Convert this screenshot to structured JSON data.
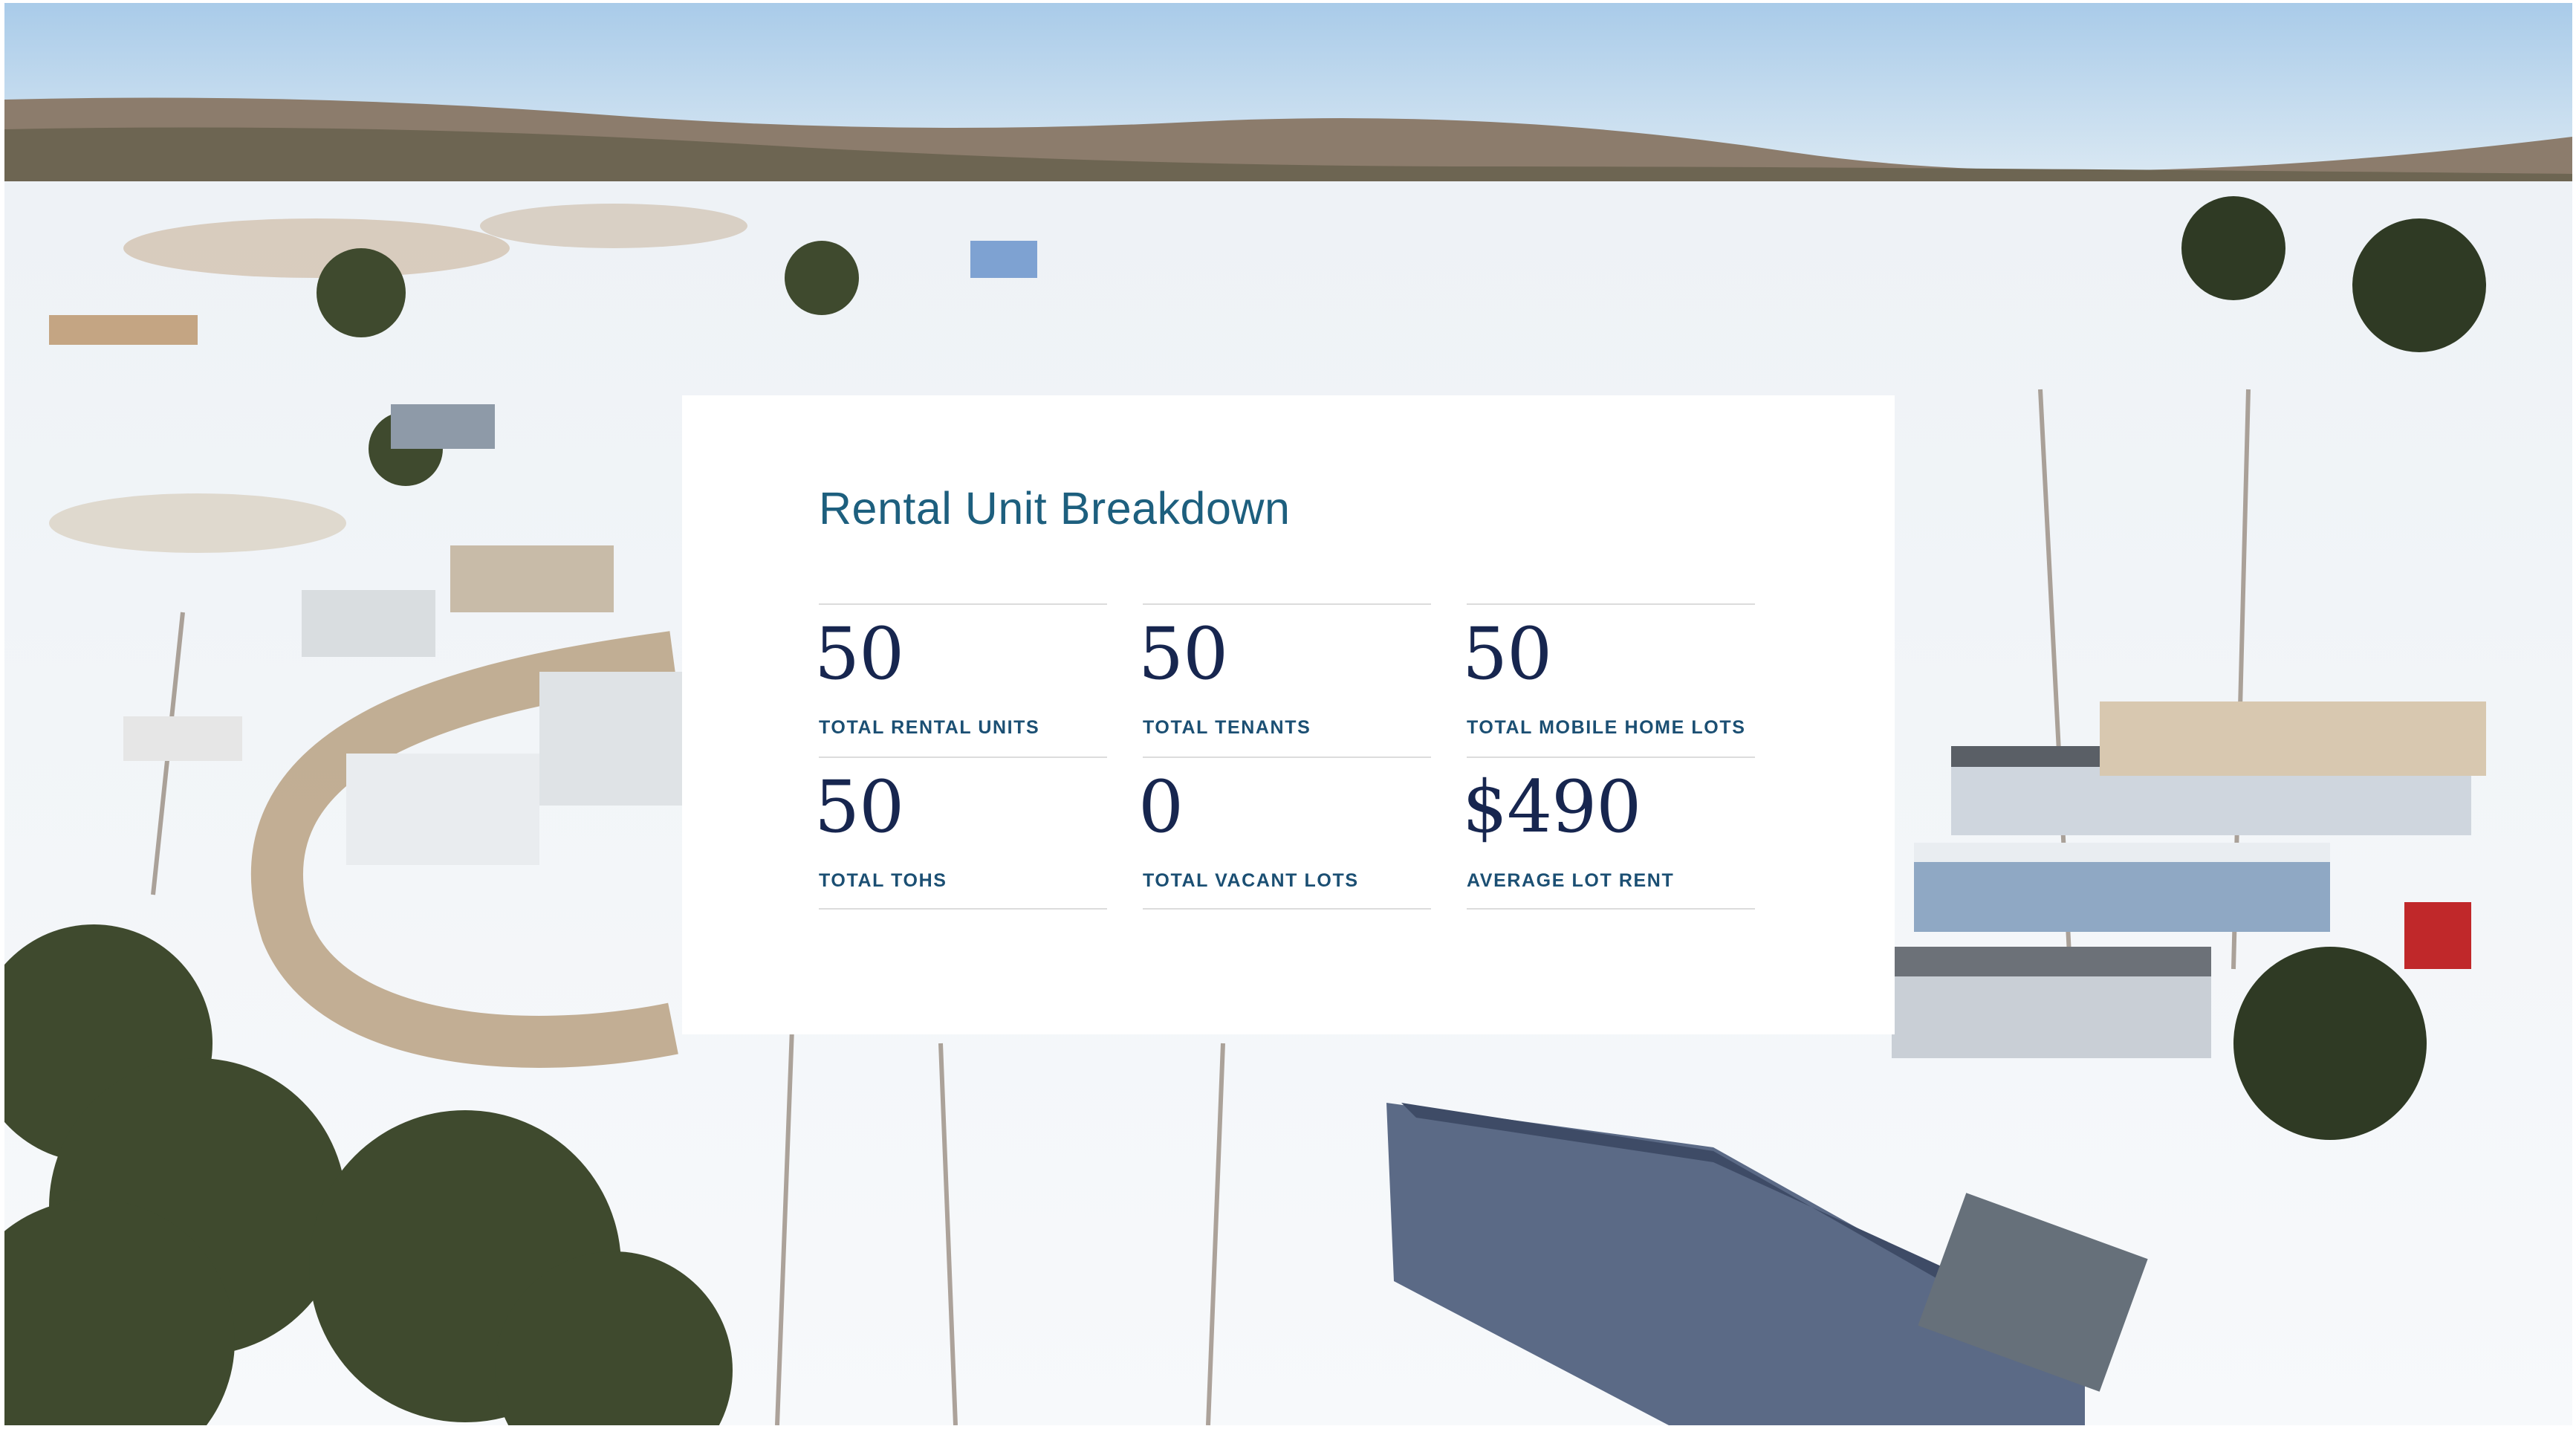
{
  "breakdown": {
    "title": "Rental Unit Breakdown",
    "stats": [
      {
        "value": "50",
        "label": "TOTAL RENTAL UNITS"
      },
      {
        "value": "50",
        "label": "TOTAL TENANTS"
      },
      {
        "value": "50",
        "label": "TOTAL MOBILE HOME LOTS"
      },
      {
        "value": "50",
        "label": "TOTAL TOHS"
      },
      {
        "value": "0",
        "label": "TOTAL VACANT LOTS"
      },
      {
        "value": "$490",
        "label": "AVERAGE LOT RENT"
      }
    ]
  },
  "colors": {
    "title": "#1d5f7e",
    "value": "#17264f",
    "label": "#1b4f73",
    "divider": "#dcdcdc",
    "card": "#ffffff"
  }
}
